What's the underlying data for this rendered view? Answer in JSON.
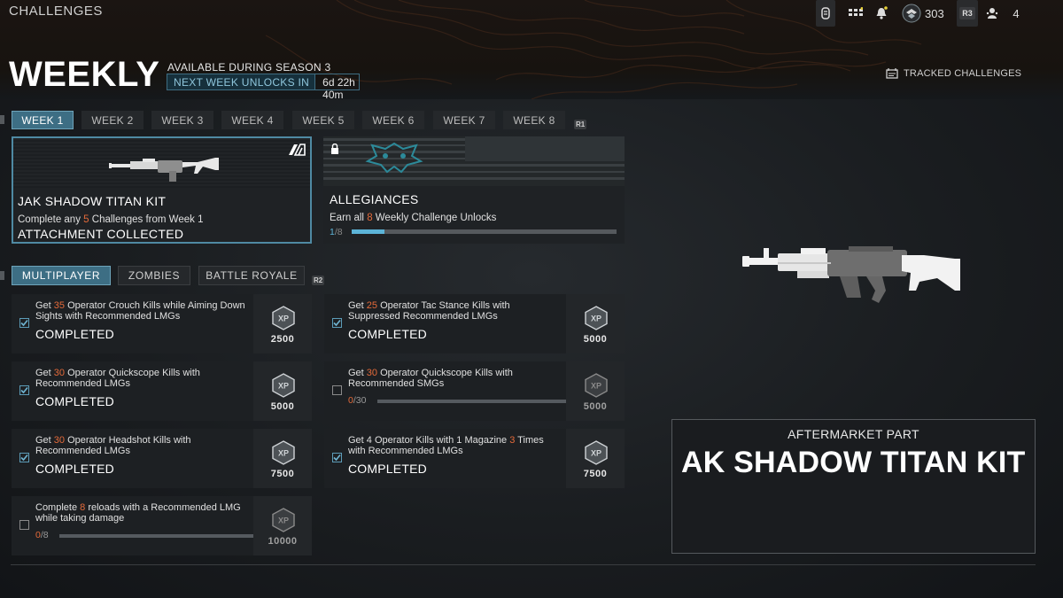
{
  "topbar": {
    "title": "CHALLENGES",
    "cod_points": "303",
    "r3_hint": "R3",
    "party_count": "4"
  },
  "header": {
    "title": "WEEKLY",
    "availability": "AVAILABLE DURING SEASON 3",
    "next_unlock_label": "NEXT WEEK UNLOCKS IN",
    "next_unlock_time": "6d 22h 40m",
    "tracked_label": "TRACKED CHALLENGES"
  },
  "week_tabs": [
    "WEEK 1",
    "WEEK 2",
    "WEEK 3",
    "WEEK 4",
    "WEEK 5",
    "WEEK 6",
    "WEEK 7",
    "WEEK 8"
  ],
  "week_tab_hint": "R1",
  "reward_cards": [
    {
      "title": "JAK SHADOW TITAN KIT",
      "desc_pre": "Complete any ",
      "desc_num": "5",
      "desc_post": " Challenges from Week 1",
      "status": "ATTACHMENT COLLECTED"
    },
    {
      "title": "ALLEGIANCES",
      "desc_pre": "Earn all ",
      "desc_num": "8",
      "desc_post": " Weekly Challenge Unlocks",
      "progress_cur": "1",
      "progress_sep": "/",
      "progress_max": "8",
      "progress_fraction": 0.125
    }
  ],
  "mode_tabs": [
    "MULTIPLAYER",
    "ZOMBIES",
    "BATTLE ROYALE"
  ],
  "mode_tab_hint": "R2",
  "challenges": [
    {
      "pre": "Get ",
      "num": "35",
      "post": " Operator Crouch Kills while Aiming Down Sights with Recommended LMGs",
      "status": "COMPLETED",
      "xp": "2500",
      "done": true
    },
    {
      "pre": "Get ",
      "num": "25",
      "post": " Operator Tac Stance Kills with Suppressed Recommended LMGs",
      "status": "COMPLETED",
      "xp": "5000",
      "done": true
    },
    {
      "pre": "Get ",
      "num": "30",
      "post": " Operator Quickscope Kills with Recommended LMGs",
      "status": "COMPLETED",
      "xp": "5000",
      "done": true
    },
    {
      "pre": "Get ",
      "num": "30",
      "post": " Operator Quickscope Kills with Recommended SMGs",
      "progress_cur": "0",
      "progress_sep": "/",
      "progress_max": "30",
      "progress_fraction": 0,
      "xp": "5000",
      "done": false
    },
    {
      "pre": "Get ",
      "num": "30",
      "post": " Operator Headshot Kills with Recommended LMGs",
      "status": "COMPLETED",
      "xp": "7500",
      "done": true
    },
    {
      "pre": "Get 4 Operator Kills with 1 Magazine ",
      "num": "3",
      "post": " Times with Recommended LMGs",
      "status": "COMPLETED",
      "xp": "7500",
      "done": true
    },
    {
      "pre": "Complete ",
      "num": "8",
      "post": " reloads with a Recommended LMG while taking damage",
      "progress_cur": "0",
      "progress_sep": "/",
      "progress_max": "8",
      "progress_fraction": 0,
      "xp": "10000",
      "done": false
    }
  ],
  "detail": {
    "subtitle": "AFTERMARKET PART",
    "name": "AK SHADOW TITAN KIT"
  },
  "colors": {
    "accent": "#3d6e84",
    "highlight": "#e46a3a",
    "progress": "#5cb4d8"
  }
}
